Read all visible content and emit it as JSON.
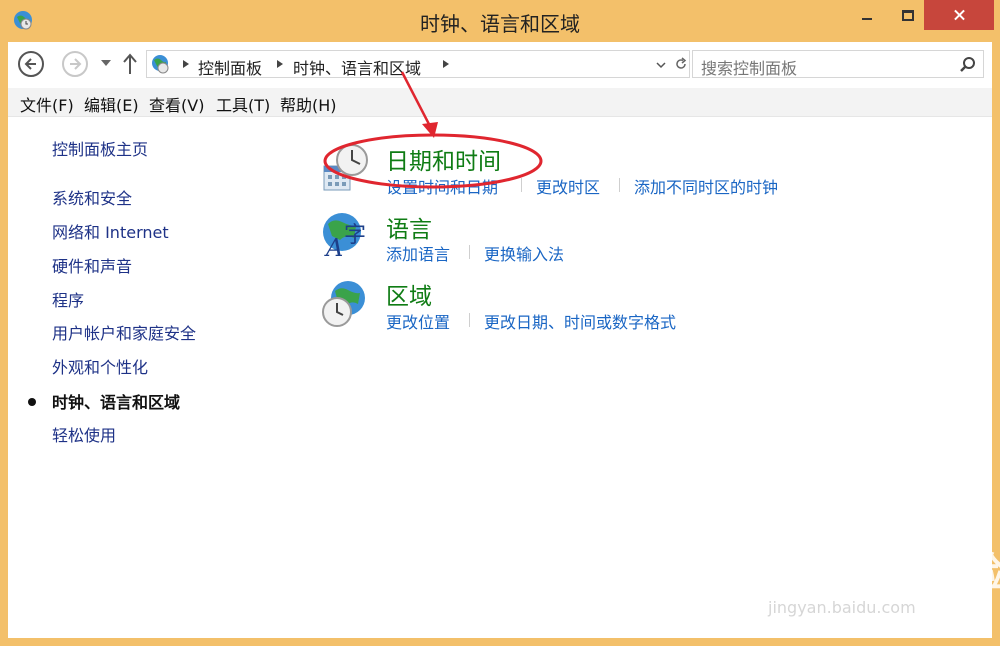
{
  "window": {
    "title": "时钟、语言和区域"
  },
  "address": {
    "crumbs": [
      "控制面板",
      "时钟、语言和区域"
    ]
  },
  "search": {
    "placeholder": "搜索控制面板"
  },
  "menu": [
    "文件(F)",
    "编辑(E)",
    "查看(V)",
    "工具(T)",
    "帮助(H)"
  ],
  "sidebar": {
    "home": "控制面板主页",
    "items": [
      "系统和安全",
      "网络和 Internet",
      "硬件和声音",
      "程序",
      "用户帐户和家庭安全",
      "外观和个性化",
      "时钟、语言和区域",
      "轻松使用"
    ],
    "current": "时钟、语言和区域"
  },
  "categories": [
    {
      "title": "日期和时间",
      "icon": "clock-calendar-icon",
      "links": [
        "设置时间和日期",
        "更改时区",
        "添加不同时区的时钟"
      ]
    },
    {
      "title": "语言",
      "icon": "globe-language-icon",
      "links": [
        "添加语言",
        "更换输入法"
      ]
    },
    {
      "title": "区域",
      "icon": "globe-clock-icon",
      "links": [
        "更改位置",
        "更改日期、时间或数字格式"
      ]
    }
  ],
  "watermark": {
    "text": "Bai du 经验",
    "sub": "jingyan.baidu.com"
  },
  "colors": {
    "title_bar": "#f3c06a",
    "category_title": "#0f7c14",
    "link": "#1a66c4",
    "sidebar_link": "#1e3287",
    "annotation": "#e0262f",
    "close_button": "#c7463c"
  }
}
